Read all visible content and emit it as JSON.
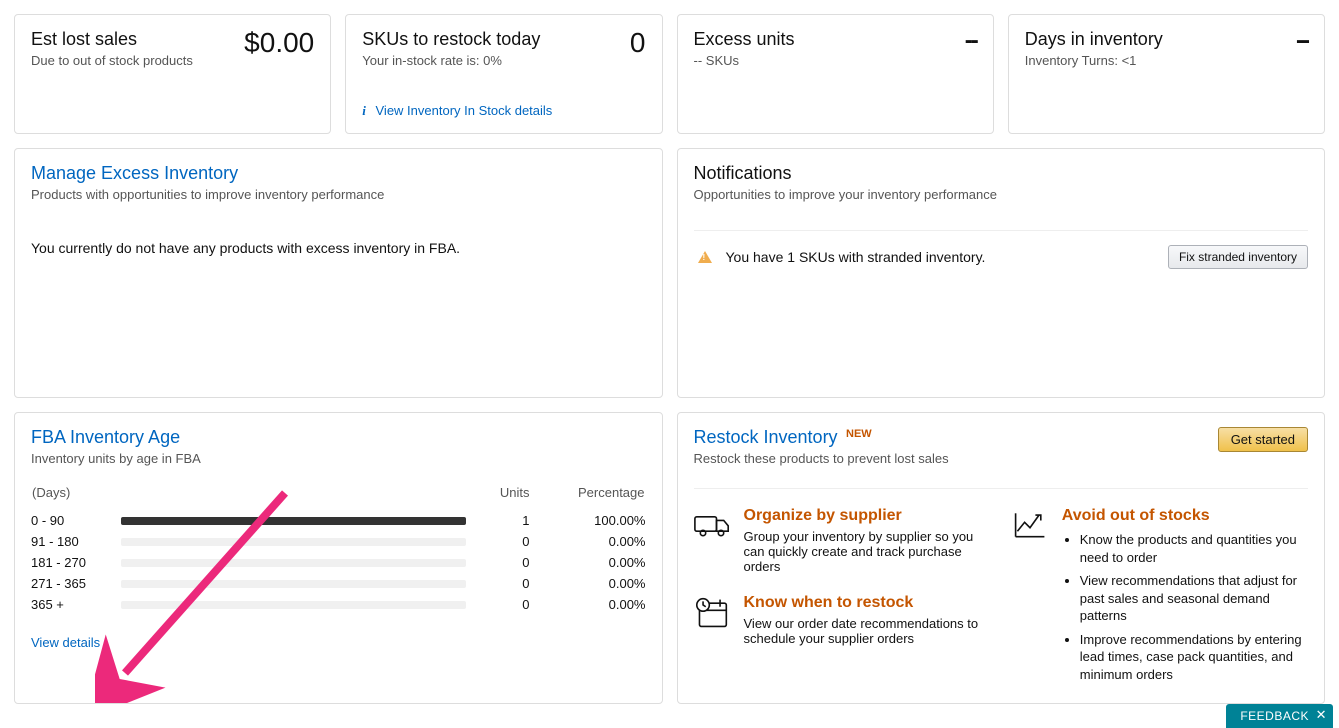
{
  "top_cards": {
    "lost_sales": {
      "title": "Est lost sales",
      "sub": "Due to out of stock products",
      "value": "$0.00"
    },
    "restock_today": {
      "title": "SKUs to restock today",
      "sub": "Your in-stock rate is: 0%",
      "value": "0",
      "link": "View Inventory In Stock details"
    },
    "excess_units": {
      "title": "Excess units",
      "sub": "-- SKUs",
      "value": "--"
    },
    "days_inventory": {
      "title": "Days in inventory",
      "sub": "Inventory Turns: <1",
      "value": "--"
    }
  },
  "manage_excess": {
    "title": "Manage Excess Inventory",
    "sub": "Products with opportunities to improve inventory performance",
    "body": "You currently do not have any products with excess inventory in FBA."
  },
  "notifications": {
    "title": "Notifications",
    "sub": "Opportunities to improve your inventory performance",
    "alert": "You have 1 SKUs with stranded inventory.",
    "button": "Fix stranded inventory"
  },
  "fba_age": {
    "title": "FBA Inventory Age",
    "sub": "Inventory units by age in FBA",
    "col_days": "(Days)",
    "col_units": "Units",
    "col_pct": "Percentage",
    "rows": [
      {
        "range": "0 - 90",
        "units": "1",
        "pct": "100.00%",
        "fill": 100
      },
      {
        "range": "91 - 180",
        "units": "0",
        "pct": "0.00%",
        "fill": 0
      },
      {
        "range": "181 - 270",
        "units": "0",
        "pct": "0.00%",
        "fill": 0
      },
      {
        "range": "271 - 365",
        "units": "0",
        "pct": "0.00%",
        "fill": 0
      },
      {
        "range": "365 +",
        "units": "0",
        "pct": "0.00%",
        "fill": 0
      }
    ],
    "view_details": "View details"
  },
  "restock": {
    "title": "Restock Inventory",
    "new": "NEW",
    "sub": "Restock these products to prevent lost sales",
    "get_started": "Get started",
    "organize": {
      "head": "Organize by supplier",
      "body": "Group your inventory by supplier so you can quickly create and track purchase orders"
    },
    "know_when": {
      "head": "Know when to restock",
      "body": "View our order date recommendations to schedule your supplier orders"
    },
    "avoid": {
      "head": "Avoid out of stocks",
      "bullets": [
        "Know the products and quantities you need to order",
        "View recommendations that adjust for past sales and seasonal demand patterns",
        "Improve recommendations by entering lead times, case pack quantities, and minimum orders"
      ]
    }
  },
  "feedback": "FEEDBACK",
  "chart_data": {
    "type": "bar",
    "categories": [
      "0 - 90",
      "91 - 180",
      "181 - 270",
      "271 - 365",
      "365 +"
    ],
    "series": [
      {
        "name": "Units",
        "values": [
          1,
          0,
          0,
          0,
          0
        ]
      },
      {
        "name": "Percentage",
        "values": [
          100.0,
          0.0,
          0.0,
          0.0,
          0.0
        ]
      }
    ],
    "title": "FBA Inventory Age",
    "xlabel": "(Days)",
    "ylabel": "Units"
  }
}
